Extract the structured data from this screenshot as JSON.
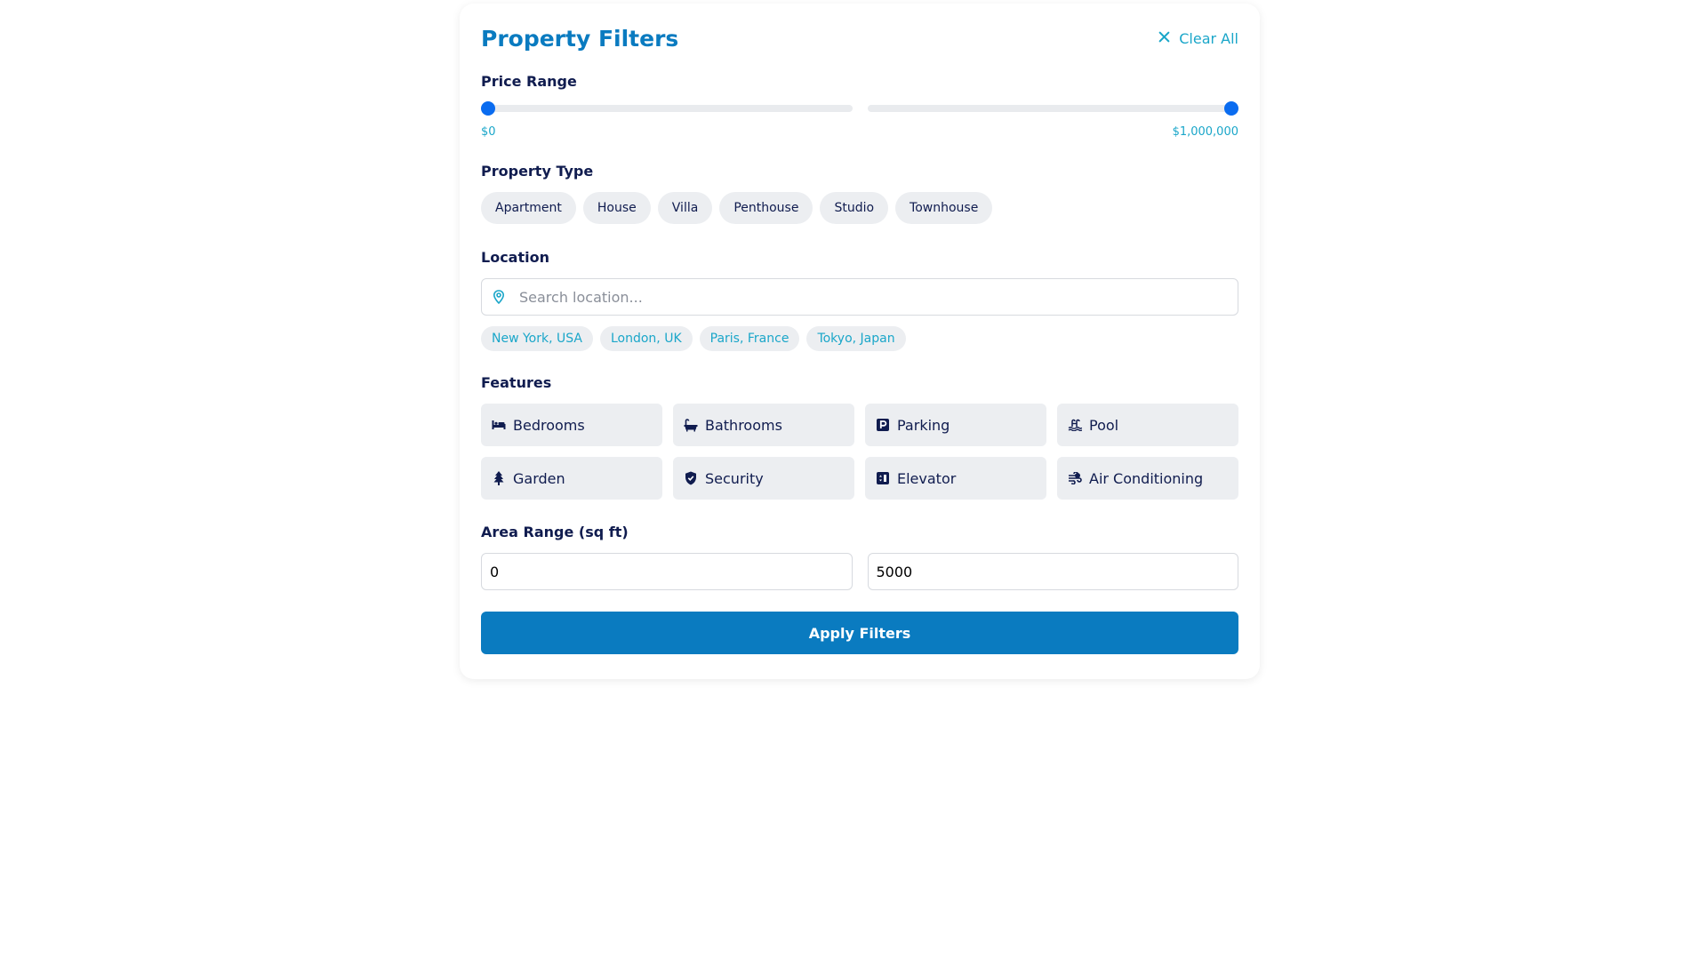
{
  "header": {
    "title": "Property Filters",
    "clear_all_label": "Clear All",
    "clear_icon": "close-icon"
  },
  "price_range": {
    "label": "Price Range",
    "min_label": "$0",
    "max_label": "$1,000,000",
    "min_value": 0,
    "max_value": 1000000
  },
  "property_type": {
    "label": "Property Type",
    "options": [
      "Apartment",
      "House",
      "Villa",
      "Penthouse",
      "Studio",
      "Townhouse"
    ]
  },
  "location": {
    "label": "Location",
    "placeholder": "Search location...",
    "icon": "map-pin-icon",
    "suggestions": [
      "New York, USA",
      "London, UK",
      "Paris, France",
      "Tokyo, Japan"
    ]
  },
  "features": {
    "label": "Features",
    "items": [
      {
        "label": "Bedrooms",
        "icon": "bed-icon"
      },
      {
        "label": "Bathrooms",
        "icon": "bath-icon"
      },
      {
        "label": "Parking",
        "icon": "parking-icon"
      },
      {
        "label": "Pool",
        "icon": "pool-icon"
      },
      {
        "label": "Garden",
        "icon": "tree-icon"
      },
      {
        "label": "Security",
        "icon": "shield-icon"
      },
      {
        "label": "Elevator",
        "icon": "elevator-icon"
      },
      {
        "label": "Air Conditioning",
        "icon": "fan-icon"
      }
    ]
  },
  "area_range": {
    "label": "Area Range (sq ft)",
    "min_value": "0",
    "max_value": "5000"
  },
  "apply_label": "Apply Filters",
  "colors": {
    "accent": "#0a7bc0",
    "link": "#1aa6c9",
    "slider": "#0a6cf0",
    "text": "#101c4f"
  }
}
